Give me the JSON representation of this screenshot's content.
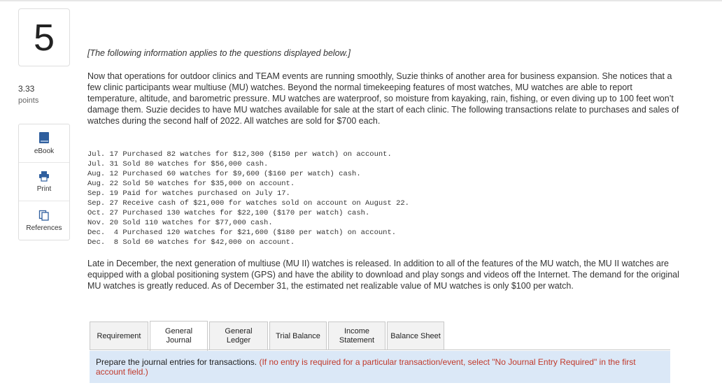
{
  "question": {
    "number": "5",
    "points_value": "3.33",
    "points_label": "points"
  },
  "tools": [
    {
      "label": "eBook",
      "icon": "book-icon"
    },
    {
      "label": "Print",
      "icon": "printer-icon"
    },
    {
      "label": "References",
      "icon": "references-icon"
    }
  ],
  "content": {
    "intro_note": "[The following information applies to the questions displayed below.]",
    "paragraph1": "Now that operations for outdoor clinics and TEAM events are running smoothly, Suzie thinks of another area for business expansion. She notices that a few clinic participants wear multiuse (MU) watches. Beyond the normal timekeeping features of most watches, MU watches are able to report temperature, altitude, and barometric pressure. MU watches are waterproof, so moisture from kayaking, rain, fishing, or even diving up to 100 feet won’t damage them. Suzie decides to have MU watches available for sale at the start of each clinic. The following transactions relate to purchases and sales of watches during the second half of 2022. All watches are sold for $700 each.",
    "transactions": [
      "Jul. 17 Purchased 82 watches for $12,300 ($150 per watch) on account.",
      "Jul. 31 Sold 80 watches for $56,000 cash.",
      "Aug. 12 Purchased 60 watches for $9,600 ($160 per watch) cash.",
      "Aug. 22 Sold 50 watches for $35,000 on account.",
      "Sep. 19 Paid for watches purchased on July 17.",
      "Sep. 27 Receive cash of $21,000 for watches sold on account on August 22.",
      "Oct. 27 Purchased 130 watches for $22,100 ($170 per watch) cash.",
      "Nov. 20 Sold 110 watches for $77,000 cash.",
      "Dec.  4 Purchased 120 watches for $21,600 ($180 per watch) on account.",
      "Dec.  8 Sold 60 watches for $42,000 on account."
    ],
    "paragraph2": "Late in December, the next generation of multiuse (MU II) watches is released. In addition to all of the features of the MU watch, the MU II watches are equipped with a global positioning system (GPS) and have the ability to download and play songs and videos off the Internet. The demand for the original MU watches is greatly reduced. As of December 31, the estimated net realizable value of MU watches is only $100 per watch."
  },
  "tabs": [
    {
      "label": "Requirement",
      "active": false
    },
    {
      "label": "General Journal",
      "active": true
    },
    {
      "label": "General Ledger",
      "active": false
    },
    {
      "label": "Trial Balance",
      "active": false
    },
    {
      "label": "Income Statement",
      "active": false
    },
    {
      "label": "Balance Sheet",
      "active": false
    }
  ],
  "instruction": {
    "main": "Prepare the journal entries for transactions.",
    "note": "(If no entry is required for a particular transaction/event, select \"No Journal Entry Required\" in the first account field.)"
  },
  "colors": {
    "instruction_bg": "#dbe8f7",
    "note_red": "#c0392b",
    "icon_blue": "#2f5f9e"
  }
}
